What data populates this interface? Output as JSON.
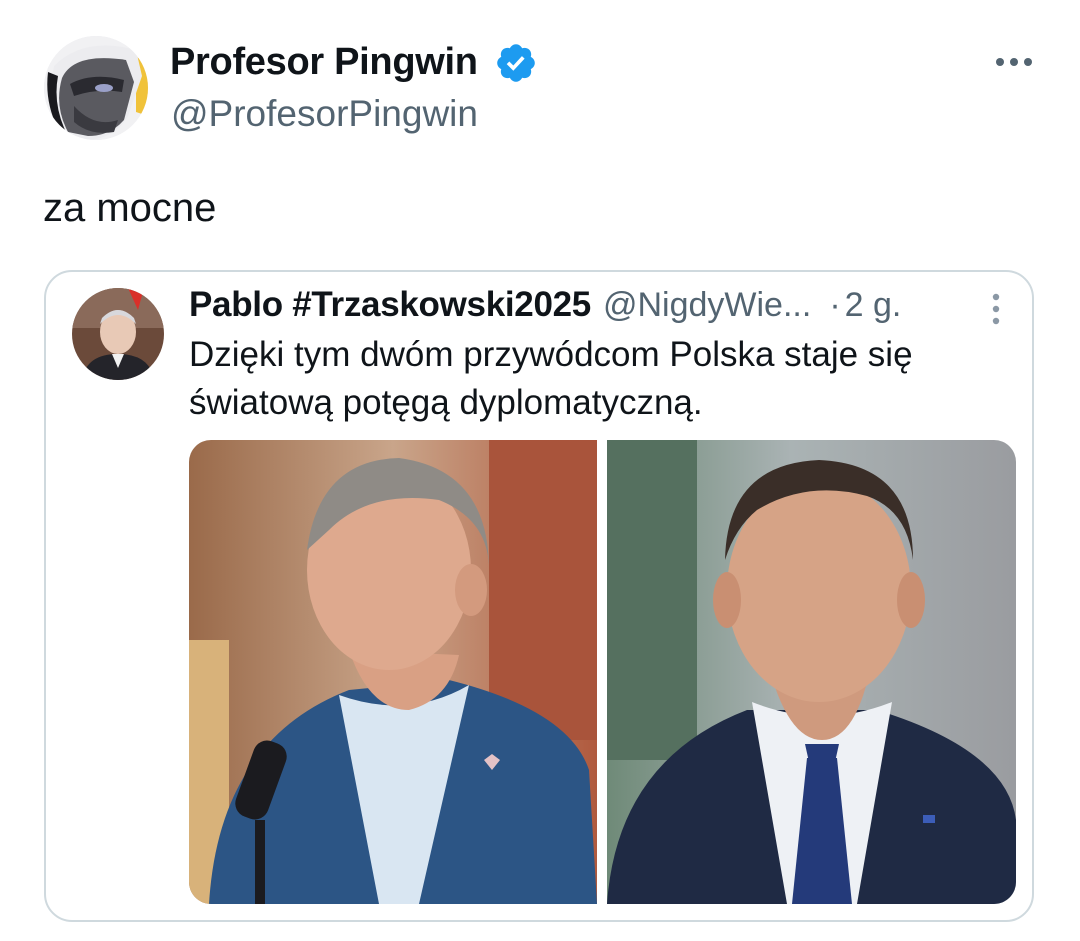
{
  "tweet": {
    "author": {
      "display_name": "Profesor Pingwin",
      "handle": "@ProfesorPingwin",
      "verified": true
    },
    "text": "za mocne",
    "quoted_tweet": {
      "author": {
        "display_name": "Pablo #Trzaskowski2025",
        "handle": "@NigdyWie...",
        "separator": "·",
        "time": "2 g."
      },
      "text_lines": [
        "Dzięki tym dwóm przywódcom Polska staje się",
        "światową potęgą dyplomatyczną."
      ],
      "media": [
        "photo-left",
        "photo-right"
      ]
    }
  },
  "colors": {
    "text": "#0f1419",
    "secondary": "#536471",
    "verified": "#1d9bf0",
    "border": "#cfd9de"
  }
}
